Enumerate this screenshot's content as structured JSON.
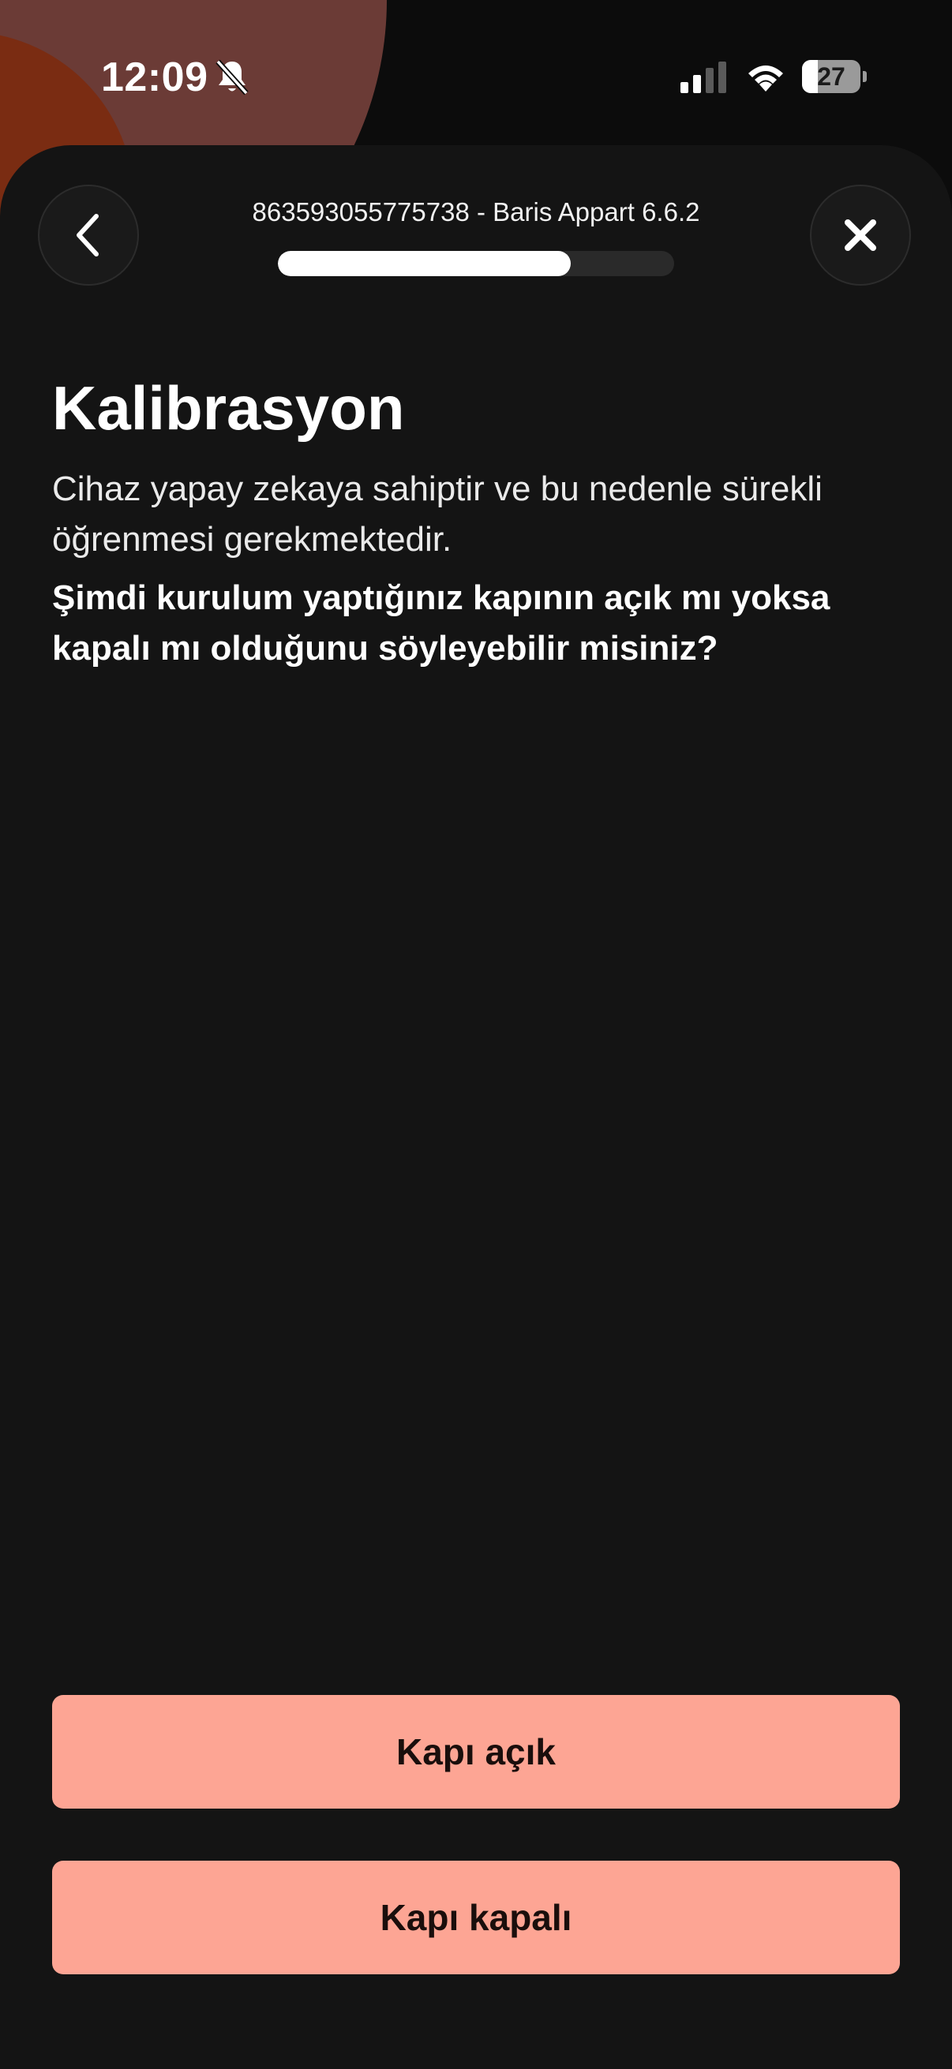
{
  "status_bar": {
    "time": "12:09",
    "battery_level": "27",
    "battery_fraction": 0.27,
    "icons": [
      "bell-muted-icon",
      "signal-icon",
      "wifi-icon",
      "battery-icon"
    ]
  },
  "header": {
    "device_label": "863593055775738 - Baris Appart 6.6.2",
    "progress_fraction": 0.74,
    "back_icon": "chevron-left-icon",
    "close_icon": "close-icon"
  },
  "content": {
    "title": "Kalibrasyon",
    "description": "Cihaz yapay zekaya sahiptir ve bu nedenle sürekli öğrenmesi gerekmektedir.",
    "question": "Şimdi kurulum yaptığınız kapının açık mı yoksa kapalı mı olduğunu söyleyebilir misiniz?"
  },
  "actions": {
    "door_open_label": "Kapı açık",
    "door_closed_label": "Kapı kapalı"
  },
  "colors": {
    "sheet_background": "#141414",
    "button_background": "#fda594",
    "blob_brown": "#6b3b36",
    "blob_rust": "#7a2c12"
  }
}
